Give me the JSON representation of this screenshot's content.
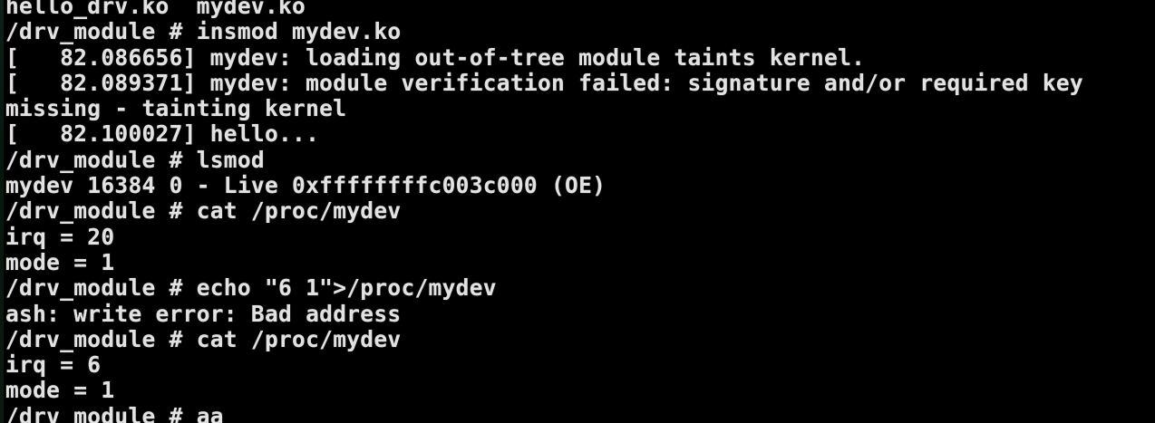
{
  "terminal": {
    "lines": [
      "hello_drv.ko  mydev.ko",
      "/drv_module # insmod mydev.ko",
      "[   82.086656] mydev: loading out-of-tree module taints kernel.",
      "[   82.089371] mydev: module verification failed: signature and/or required key",
      "missing - tainting kernel",
      "[   82.100027] hello...",
      "/drv_module # lsmod",
      "mydev 16384 0 - Live 0xffffffffc003c000 (OE)",
      "/drv_module # cat /proc/mydev",
      "irq = 20",
      "mode = 1",
      "/drv_module # echo \"6 1\">/proc/mydev",
      "ash: write error: Bad address",
      "/drv_module # cat /proc/mydev",
      "irq = 6",
      "mode = 1",
      "/drv_module # aa"
    ]
  }
}
